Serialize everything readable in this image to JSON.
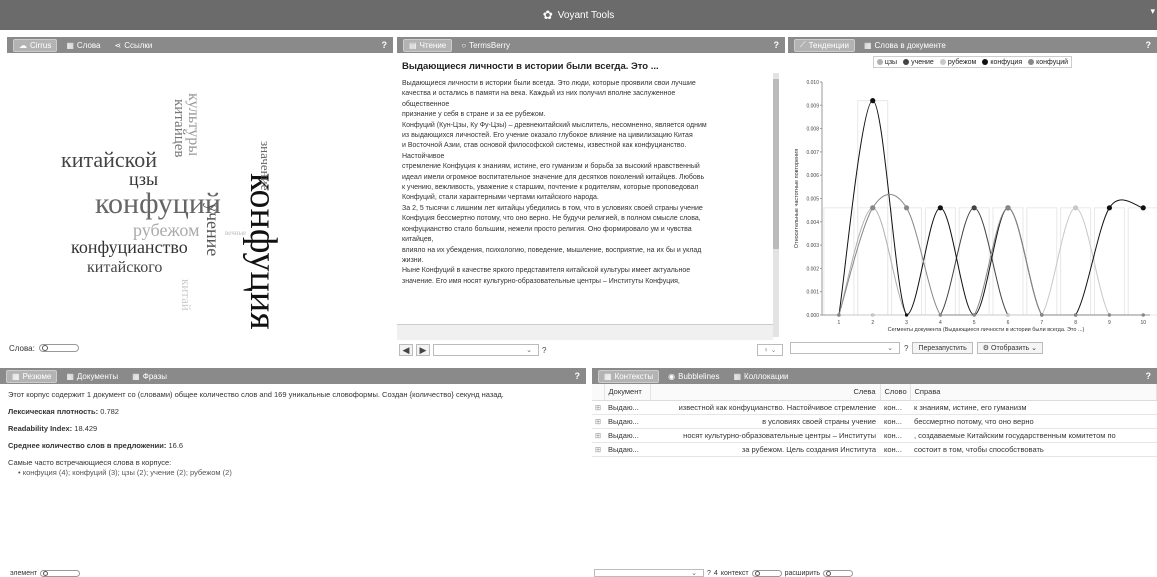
{
  "app": {
    "title": "Voyant Tools"
  },
  "cirrus": {
    "tabs": [
      {
        "label": "Cirrus",
        "icon": "cloud-icon"
      },
      {
        "label": "Слова",
        "icon": "table-icon"
      },
      {
        "label": "Ссылки",
        "icon": "share-icon"
      }
    ],
    "help": "?",
    "footer_label": "Слова:",
    "words": [
      "конфуция",
      "конфуций",
      "китайской",
      "конфуцианство",
      "китайского",
      "рубежом",
      "учение",
      "цзы",
      "культуры",
      "китайцев",
      "значение",
      "китай",
      "вечные"
    ]
  },
  "reader": {
    "tabs": [
      {
        "label": "Чтение",
        "icon": "document-icon"
      },
      {
        "label": "TermsBerry",
        "icon": "circle-icon"
      }
    ],
    "help": "?",
    "title": "Выдающиеся личности в истории были всегда. Это ...",
    "text": "Выдающиеся личности в истории были всегда. Это люди, которые проявили свои лучшие\nкачества и остались в памяти на века. Каждый из них получил вполне заслуженное\nобщественное\nпризнание у себя в стране и за ее рубежом.\nКонфуций (Кун-Цзы, Ку Фу-Цзы) – древнекитайский мыслитель, несомненно, является одним\nиз выдающихся личностей. Его учение оказало глубокое влияние на цивилизацию Китая\nи Восточной Азии, став основой философской системы, известной как конфуцианство.\nНастойчивое\nстремление Конфуция к знаниям, истине, его гуманизм и борьба за высокий нравственный\nидеал имели огромное воспитательное значение для десятков поколений китайцев. Любовь\nк учению, вежливость, уважение к старшим, почтение к родителям, которые проповедовал\nКонфуций, стали характерными чертами китайского народа.\nЗа 2, 5 тысячи с лишним лет китайцы убедились в том, что в условиях своей страны учение\nКонфуция бессмертно потому, что оно верно. Не будучи религией, в полном смысле слова,\nконфуцианство стало большим, нежели просто религия. Оно формировало ум и чувства\nкитайцев,\nвлияло на их убеждения, психологию, поведение, мышление, восприятие, на их бы и уклад\nжизни.\nНыне Конфуций в качестве яркого представителя китайской культуры имеет актуальное\nзначение. Его имя носят культурно-образовательные центры – Институты Конфуция,",
    "footer_help": "?"
  },
  "trends": {
    "tabs": [
      {
        "label": "Тенденции",
        "icon": "line-chart-icon"
      },
      {
        "label": "Слова в документе",
        "icon": "table-icon"
      }
    ],
    "help": "?",
    "buttons": {
      "reset": "Перезапустить",
      "display": "Отобразить"
    },
    "footer_help": "?"
  },
  "chart_data": {
    "type": "line",
    "xlabel": "Сегменты документа (Выдающиеся личности в истории были всегда. Это ...)",
    "ylabel": "Относительные частотные повторения",
    "x": [
      1,
      2,
      3,
      4,
      5,
      6,
      7,
      8,
      9,
      10
    ],
    "ylim": [
      0,
      0.01
    ],
    "yticks": [
      "0.000",
      "0.001",
      "0.002",
      "0.003",
      "0.004",
      "0.005",
      "0.006",
      "0.007",
      "0.008",
      "0.009",
      "0.010"
    ],
    "series": [
      {
        "name": "цзы",
        "color": "#b0b0b0",
        "values": [
          0,
          0.0046,
          0,
          0,
          0,
          0,
          0,
          0,
          0,
          0
        ]
      },
      {
        "name": "учение",
        "color": "#444444",
        "values": [
          0,
          0,
          0,
          0,
          0.0046,
          0,
          0,
          0,
          0,
          0
        ]
      },
      {
        "name": "рубежом",
        "color": "#c8c8c8",
        "values": [
          0,
          0,
          0,
          0,
          0,
          0,
          0,
          0.0046,
          0,
          0
        ]
      },
      {
        "name": "конфуция",
        "color": "#111111",
        "values": [
          0,
          0.0092,
          0,
          0.0046,
          0,
          0.0046,
          0,
          0,
          0.0046,
          0.0046
        ]
      },
      {
        "name": "конфуций",
        "color": "#888888",
        "values": [
          0,
          0.0046,
          0.0046,
          0,
          0,
          0.0046,
          0,
          0,
          0,
          0
        ]
      }
    ],
    "grid": true
  },
  "summary": {
    "tabs": [
      {
        "label": "Резюме",
        "icon": "table-icon"
      },
      {
        "label": "Документы",
        "icon": "table-icon"
      },
      {
        "label": "Фразы",
        "icon": "table-icon"
      }
    ],
    "help": "?",
    "intro": "Этот корпус содержит 1 документ со (словами) общее количество слов and 169 уникальные словоформы. Создан {количество} секунд назад.",
    "density_label": "Лексическая плотность:",
    "density_value": "0.782",
    "readability_label": "Readability Index:",
    "readability_value": "18.429",
    "avg_label": "Среднее количество слов в предложении:",
    "avg_value": "16.6",
    "frequent_label": "Самые часто встречающиеся слова в корпусе:",
    "frequent_items": "конфуция (4); конфуций (3); цзы (2); учение (2); рубежом (2)",
    "footer_label": "элемент"
  },
  "contexts": {
    "tabs": [
      {
        "label": "Контексты",
        "icon": "table-icon"
      },
      {
        "label": "Bubblelines",
        "icon": "eye-icon"
      },
      {
        "label": "Коллокации",
        "icon": "table-icon"
      }
    ],
    "help": "?",
    "columns": {
      "doc": "Документ",
      "left": "Слева",
      "word": "Слово",
      "right": "Справа"
    },
    "rows": [
      {
        "doc": "Выдаю...",
        "left": "известной как конфуцианство. Настойчивое стремление",
        "word": "кон...",
        "right": "к знаниям, истине, его гуманизм"
      },
      {
        "doc": "Выдаю...",
        "left": "в условиях своей страны учение",
        "word": "кон...",
        "right": "бессмертно потому, что оно верно"
      },
      {
        "doc": "Выдаю...",
        "left": "носят культурно-образовательные центры – Институты",
        "word": "кон...",
        "right": ", создаваемые Китайским государственным комитетом по"
      },
      {
        "doc": "Выдаю...",
        "left": "за рубежом. Цель создания Института",
        "word": "кон...",
        "right": "состоит в том, чтобы способствовать"
      }
    ],
    "footer": {
      "help": "?",
      "count": "4",
      "context_label": "контекст",
      "expand_label": "расширить"
    }
  }
}
